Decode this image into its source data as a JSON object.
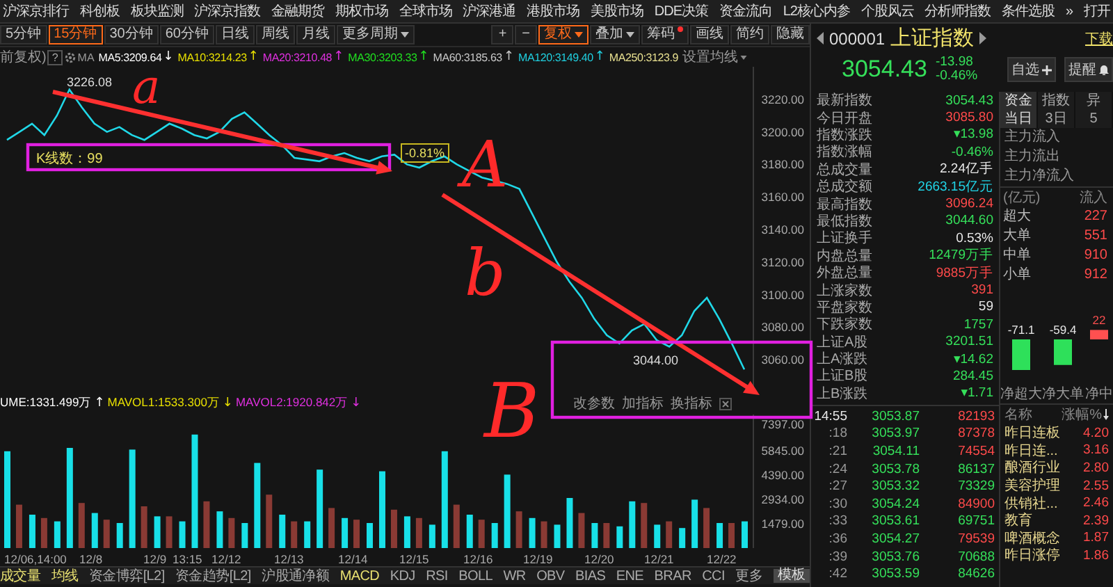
{
  "menu": {
    "items": [
      "沪深京排行",
      "科创板",
      "板块监测",
      "沪深京指数",
      "金融期货",
      "期权市场",
      "全球市场",
      "沪深港通",
      "港股市场",
      "美股市场",
      "DDE决策",
      "资金流向",
      "L2核心内参",
      "个股风云",
      "分析师指数",
      "条件选股"
    ],
    "more": "»",
    "open": "打开"
  },
  "toolbar": {
    "periods": [
      {
        "label": "5分钟",
        "selected": false
      },
      {
        "label": "15分钟",
        "selected": true
      },
      {
        "label": "30分钟",
        "selected": false
      },
      {
        "label": "60分钟",
        "selected": false
      },
      {
        "label": "日线",
        "selected": false
      },
      {
        "label": "周线",
        "selected": false
      },
      {
        "label": "月线",
        "selected": false
      }
    ],
    "more_periods": "更多周期",
    "zoom_in": "+",
    "zoom_out": "−",
    "buttons": [
      {
        "label": "复权",
        "kind": "dropdown",
        "active": true
      },
      {
        "label": "叠加",
        "kind": "dropdown",
        "active": false
      },
      {
        "label": "筹码",
        "kind": "dot",
        "active": false
      },
      {
        "label": "画线",
        "kind": "plain",
        "active": false
      },
      {
        "label": "简约",
        "kind": "plain",
        "active": false
      },
      {
        "label": "隐藏",
        "kind": "plain",
        "active": false
      }
    ]
  },
  "ma_bar": {
    "adjust": "前复权)",
    "help": "?",
    "label": "MA",
    "settings": "设置均线",
    "items": [
      {
        "text": "MA5:3209.64",
        "color": "#ffffff",
        "arrow": "↓"
      },
      {
        "text": "MA10:3214.23",
        "color": "#e8e000",
        "arrow": "↑"
      },
      {
        "text": "MA20:3210.48",
        "color": "#e030e0",
        "arrow": "↑"
      },
      {
        "text": "MA30:3203.33",
        "color": "#20e020",
        "arrow": "↑"
      },
      {
        "text": "MA60:3185.63",
        "color": "#c8c8c8",
        "arrow": "↑"
      },
      {
        "text": "MA120:3149.40",
        "color": "#20d0e0",
        "arrow": "↑"
      },
      {
        "text": "MA250:3123.9",
        "color": "#e8e090"
      }
    ]
  },
  "chart": {
    "chart_data": {
      "type": "line",
      "ylim": [
        3040,
        3240
      ],
      "yticks": [
        {
          "value": 3060,
          "label": "3060.00"
        },
        {
          "value": 3080,
          "label": "3080.00"
        },
        {
          "value": 3100,
          "label": "3100.00"
        },
        {
          "value": 3120,
          "label": "3120.00"
        },
        {
          "value": 3140,
          "label": "3140.00"
        },
        {
          "value": 3160,
          "label": "3160.00"
        },
        {
          "value": 3180,
          "label": "3180.00"
        },
        {
          "value": 3200,
          "label": "3200.00"
        },
        {
          "value": 3220,
          "label": "3220.00"
        }
      ],
      "series": [
        {
          "color": "#20d8e8",
          "values": [
            3195,
            3200,
            3205,
            3198,
            3210,
            3226,
            3215,
            3205,
            3200,
            3203,
            3198,
            3195,
            3200,
            3205,
            3202,
            3198,
            3196,
            3200,
            3208,
            3212,
            3205,
            3198,
            3192,
            3184,
            3183,
            3182,
            3185,
            3187,
            3184,
            3182,
            3185,
            3186,
            3180,
            3178,
            3182,
            3185,
            3180,
            3176,
            3172,
            3170,
            3168,
            3165,
            3150,
            3135,
            3120,
            3108,
            3098,
            3085,
            3075,
            3070,
            3078,
            3082,
            3072,
            3068,
            3075,
            3090,
            3098,
            3085,
            3070,
            3054
          ]
        }
      ]
    },
    "annotations": [
      {
        "kind": "letter",
        "text": "a"
      },
      {
        "kind": "letter",
        "text": "A"
      },
      {
        "kind": "letter",
        "text": "b"
      },
      {
        "kind": "letter",
        "text": "B"
      },
      {
        "kind": "price",
        "text": "3226.08"
      },
      {
        "kind": "price",
        "text": "3044.00"
      },
      {
        "kind": "box",
        "text": "K线数：99"
      },
      {
        "kind": "percent",
        "text": "-0.81%"
      },
      {
        "kind": "arrow"
      },
      {
        "kind": "arrow"
      },
      {
        "kind": "box"
      }
    ]
  },
  "volume": {
    "legend": [
      {
        "text": "UME:1331.499万",
        "color": "#ffffff",
        "arrow": "↑"
      },
      {
        "text": "MAVOL1:1533.300万",
        "color": "#e8e000",
        "arrow": "↓"
      },
      {
        "text": "MAVOL2:1920.842万",
        "color": "#e030e0",
        "arrow": "↓"
      }
    ],
    "actions": [
      "改参数",
      "加指标",
      "换指标"
    ],
    "time_axis": [
      "12/06,14:00",
      "12/8",
      "12/9",
      "13:15",
      "12/12",
      "12/13",
      "12/14",
      "12/15",
      "12/16",
      "12/19",
      "12/20",
      "12/21",
      "12/22"
    ],
    "chart_data": {
      "type": "bar",
      "ylim": [
        0,
        8000
      ],
      "stacked": false,
      "yticks": [
        {
          "value": 1479,
          "label": "1479.00"
        },
        {
          "value": 2934,
          "label": "2934.00"
        },
        {
          "value": 4390,
          "label": "4390.00"
        },
        {
          "value": 5845,
          "label": "5845.00"
        },
        {
          "value": 7397,
          "label": "7397.00"
        }
      ],
      "series": [
        {
          "color": "#8a3a34",
          "values": [
            null,
            2600,
            null,
            1800,
            null,
            null,
            2700,
            null,
            1700,
            null,
            null,
            2500,
            null,
            1900,
            null,
            null,
            2800,
            null,
            1800,
            null,
            null,
            3200,
            null,
            1600,
            null,
            null,
            2400,
            null,
            1700,
            null,
            null,
            2300,
            null,
            1800,
            null,
            null,
            2600,
            null,
            1700,
            null,
            null,
            2200,
            null,
            1600,
            null,
            null,
            2100,
            null,
            1500,
            null,
            null,
            2700,
            null,
            1600,
            null,
            null,
            2400,
            null,
            1500,
            null
          ]
        },
        {
          "color": "#18e0e8",
          "values": [
            5800,
            null,
            2000,
            null,
            1600,
            6000,
            null,
            2100,
            null,
            1500,
            5900,
            null,
            1900,
            null,
            1600,
            6800,
            null,
            2200,
            null,
            1500,
            5100,
            null,
            2000,
            null,
            1600,
            4700,
            null,
            1800,
            null,
            1500,
            4600,
            null,
            1900,
            null,
            1400,
            5800,
            null,
            2000,
            null,
            1500,
            4400,
            null,
            1800,
            null,
            1400,
            3000,
            null,
            1500,
            null,
            1300,
            2800,
            null,
            1400,
            null,
            1200,
            2900,
            null,
            1500,
            null,
            1600
          ]
        }
      ]
    }
  },
  "bottom_tabs": [
    {
      "label": "成交量",
      "kind": "tab",
      "highlighted": true
    },
    {
      "label": "均线",
      "kind": "tab",
      "highlighted": true
    },
    {
      "label": "资金博弈[L2]",
      "kind": "tab",
      "highlighted": false
    },
    {
      "label": "资金趋势[L2]",
      "kind": "tab",
      "highlighted": false
    },
    {
      "label": "沪股通净额",
      "kind": "tab",
      "highlighted": false
    },
    {
      "label": "MACD",
      "kind": "tab",
      "highlighted": true
    },
    {
      "label": "KDJ",
      "kind": "tab",
      "highlighted": false
    },
    {
      "label": "RSI",
      "kind": "tab",
      "highlighted": false
    },
    {
      "label": "BOLL",
      "kind": "tab",
      "highlighted": false
    },
    {
      "label": "WR",
      "kind": "tab",
      "highlighted": false
    },
    {
      "label": "OBV",
      "kind": "tab",
      "highlighted": false
    },
    {
      "label": "BIAS",
      "kind": "tab",
      "highlighted": false
    },
    {
      "label": "ENE",
      "kind": "tab",
      "highlighted": false
    },
    {
      "label": "BRAR",
      "kind": "tab",
      "highlighted": false
    },
    {
      "label": "CCI",
      "kind": "tab",
      "highlighted": false
    },
    {
      "label": "更多",
      "kind": "tab",
      "highlighted": false
    },
    {
      "label": "模板",
      "kind": "button",
      "highlighted": true
    }
  ],
  "quote": {
    "code": "000001",
    "name": "上证指数",
    "download": "下载",
    "price": "3054.43",
    "change": "-13.98",
    "change_pct": "-0.46%",
    "falling": true,
    "watch_button": "自选",
    "remind_button": "提醒"
  },
  "stats": [
    {
      "label": "最新指数",
      "value": "3054.43",
      "color": "#35e05a"
    },
    {
      "label": "今日开盘",
      "value": "3085.80",
      "color": "#ff4a4a"
    },
    {
      "label": "指数涨跌",
      "value": "▾13.98",
      "color": "#35e05a"
    },
    {
      "label": "指数涨幅",
      "value": "-0.46%",
      "color": "#35e05a"
    },
    {
      "label": "总成交量",
      "value": "2.24亿手",
      "color": "#e8e8e8"
    },
    {
      "label": "总成交额",
      "value": "2663.15亿元",
      "color": "#21d4e6"
    },
    {
      "label": "最高指数",
      "value": "3096.24",
      "color": "#ff4a4a"
    },
    {
      "label": "最低指数",
      "value": "3044.60",
      "color": "#35e05a"
    },
    {
      "label": "上证换手",
      "value": "0.53%",
      "color": "#e8e8e8"
    },
    {
      "label": "内盘总量",
      "value": "12479万手",
      "color": "#35e05a"
    },
    {
      "label": "外盘总量",
      "value": "9885万手",
      "color": "#ff4a4a"
    },
    {
      "label": "上涨家数",
      "value": "391",
      "color": "#ff4a4a"
    },
    {
      "label": "平盘家数",
      "value": "59",
      "color": "#e8e8e8"
    },
    {
      "label": "下跌家数",
      "value": "1757",
      "color": "#35e05a"
    },
    {
      "label": "上证A股",
      "value": "3201.51",
      "color": "#35e05a"
    },
    {
      "label": "上A涨跌",
      "value": "▾14.62",
      "color": "#35e05a"
    },
    {
      "label": "上证B股",
      "value": "284.45",
      "color": "#35e05a"
    },
    {
      "label": "上B涨跌",
      "value": "▾1.71",
      "color": "#35e05a"
    }
  ],
  "ticks": [
    {
      "time": "14:55",
      "price": "3053.87",
      "volume": "82193",
      "color": "#ff4a4a"
    },
    {
      "time": ":18",
      "price": "3053.97",
      "volume": "87378",
      "color": "#ff4a4a"
    },
    {
      "time": ":21",
      "price": "3054.11",
      "volume": "74554",
      "color": "#ff4a4a"
    },
    {
      "time": ":24",
      "price": "3053.78",
      "volume": "86137",
      "color": "#35e05a"
    },
    {
      "time": ":27",
      "price": "3053.32",
      "volume": "73329",
      "color": "#35e05a"
    },
    {
      "time": ":30",
      "price": "3054.24",
      "volume": "84900",
      "color": "#ff4a4a"
    },
    {
      "time": ":33",
      "price": "3053.61",
      "volume": "69751",
      "color": "#35e05a"
    },
    {
      "time": ":36",
      "price": "3054.27",
      "volume": "79539",
      "color": "#ff4a4a"
    },
    {
      "time": ":39",
      "price": "3053.76",
      "volume": "70688",
      "color": "#35e05a"
    },
    {
      "time": ":42",
      "price": "3053.59",
      "volume": "84626",
      "color": "#35e05a"
    }
  ],
  "fund_flow": {
    "tabs": [
      {
        "label": "资金",
        "selected": true
      },
      {
        "label": "指数",
        "selected": false
      },
      {
        "label": "异",
        "selected": false
      }
    ],
    "periods": [
      {
        "label": "当日",
        "selected": true
      },
      {
        "label": "3日",
        "selected": false
      },
      {
        "label": "5",
        "selected": false
      }
    ],
    "rows": [
      "主力流入",
      "主力流出",
      "主力净流入"
    ],
    "unit": "(亿元)",
    "column": "流入",
    "orders": [
      {
        "label": "超大",
        "value": "227"
      },
      {
        "label": "大单",
        "value": "551"
      },
      {
        "label": "中单",
        "value": "910"
      },
      {
        "label": "小单",
        "value": "912"
      }
    ],
    "chart_data": {
      "type": "bar",
      "categories": [
        "净超大",
        "净大单",
        "净中"
      ],
      "values": [
        -71.1,
        -59.4,
        22
      ],
      "value_labels": [
        "-71.1",
        "-59.4",
        "22"
      ]
    }
  },
  "sectors": {
    "name_header": "名称",
    "change_header": "涨幅%",
    "items": [
      {
        "name": "昨日连板",
        "change": "4.20"
      },
      {
        "name": "昨日连...",
        "change": "3.16"
      },
      {
        "name": "酿酒行业",
        "change": "2.80"
      },
      {
        "name": "美容护理",
        "change": "2.55"
      },
      {
        "name": "供销社...",
        "change": "2.46"
      },
      {
        "name": "教育",
        "change": "2.39"
      },
      {
        "name": "啤酒概念",
        "change": "1.87"
      },
      {
        "name": "昨日涨停",
        "change": "1.86"
      }
    ]
  }
}
